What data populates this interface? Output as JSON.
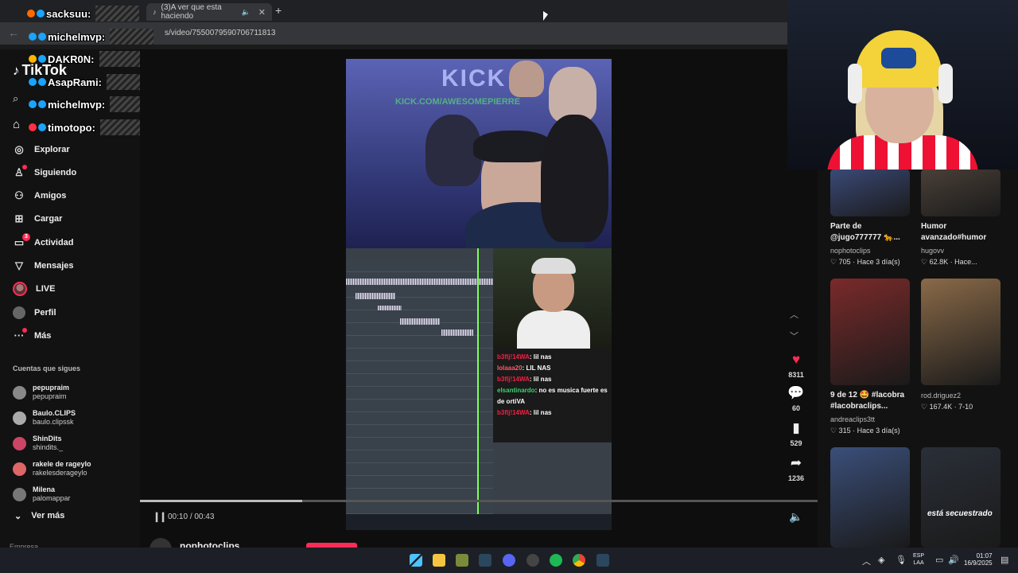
{
  "browser": {
    "tabs": [
      {
        "title": "(3)A ver que esta haciendo",
        "active": true
      }
    ],
    "url": "s/video/7550079590706711813"
  },
  "chat_overlay": [
    {
      "user": "sacksuu:",
      "color": "#ff6a00"
    },
    {
      "user": "michelmvp:",
      "color": "#1aa3ff"
    },
    {
      "user": "DAKR0N:",
      "color": "#ffb400"
    },
    {
      "user": "AsapRami:",
      "color": "#1aa3ff"
    },
    {
      "user": "michelmvp:",
      "color": "#1aa3ff"
    },
    {
      "user": "timotopo:",
      "color": "#ff3040"
    }
  ],
  "sidebar": {
    "logo": "TikTok",
    "items": [
      {
        "label": "Explorar",
        "icon": "compass-icon",
        "glyph": "◎"
      },
      {
        "label": "Siguiendo",
        "icon": "person-icon",
        "glyph": "👤"
      },
      {
        "label": "Amigos",
        "icon": "friends-icon",
        "glyph": "👥"
      },
      {
        "label": "Cargar",
        "icon": "upload-icon",
        "glyph": "⊞"
      },
      {
        "label": "Actividad",
        "icon": "activity-icon",
        "glyph": "▭",
        "badge": "3"
      },
      {
        "label": "Mensajes",
        "icon": "messages-icon",
        "glyph": "▽"
      },
      {
        "label": "LIVE",
        "icon": "live-icon"
      },
      {
        "label": "Perfil",
        "icon": "profile-icon"
      },
      {
        "label": "Más",
        "icon": "more-icon",
        "glyph": "···"
      }
    ],
    "following_title": "Cuentas que sigues",
    "following": [
      {
        "name": "pepupraim",
        "handle": "pepupraim",
        "color": "#888"
      },
      {
        "name": "Baulo.CLIPS",
        "handle": "baulo.clipssk",
        "color": "#aaa"
      },
      {
        "name": "ShinDits",
        "handle": "shindits._",
        "color": "#c46"
      },
      {
        "name": "rakele de rageylo",
        "handle": "rakelesderageylo",
        "color": "#d66"
      },
      {
        "name": "Milena",
        "handle": "palomappar",
        "color": "#777"
      }
    ],
    "see_more": "Ver más",
    "section_hint": "Empresa"
  },
  "video": {
    "watermark": "KICK",
    "watermark_url": "KICK.COM/AWESOMEPIERRE",
    "chat": [
      {
        "user": "b3flj!14WA",
        "text": ": lil nas",
        "cls": "u1"
      },
      {
        "user": "lolaaa20",
        "text": ": LIL NAS",
        "cls": "u2"
      },
      {
        "user": "b3flj!14WA",
        "text": ": lil nas",
        "cls": "u1"
      },
      {
        "user": "elsantinardo",
        "text": ": no es musica fuerte es de ortiVA",
        "cls": "u3"
      },
      {
        "user": "b3flj!14WA",
        "text": ": lil nas",
        "cls": "u1"
      }
    ],
    "current_time": "00:10",
    "duration": "00:43",
    "progress": 0.24,
    "author": "nophotoclips"
  },
  "actions": {
    "likes": "8311",
    "comments": "60",
    "saves": "529",
    "shares": "1236"
  },
  "recommendations": [
    {
      "title": "Parte de @jugo777777 🐆...",
      "author": "nophotoclips",
      "meta": "♡ 705 · Hace 3 día(s)",
      "tone": "#3b4a78"
    },
    {
      "title": "Humor avanzado#humor",
      "author": "hugovv",
      "meta": "♡ 62.8K · Hace...",
      "tone": "#4a4038"
    },
    {
      "title": "9 de 12 🤩 #lacobra #lacobraclips...",
      "author": "andreaclips3tt",
      "meta": "♡ 315 · Hace 3 día(s)",
      "tone": "#7a2a2a"
    },
    {
      "title": "",
      "author": "rod.driguez2",
      "meta": "♡ 167.4K · 7-10",
      "tone": "#8a6a48"
    },
    {
      "title": "",
      "author": "",
      "meta": "",
      "tone": "#3b4f7a"
    },
    {
      "title": "",
      "author": "",
      "meta": "",
      "tone": "#2a2f38",
      "caption": "está secuestrado"
    }
  ],
  "taskbar": {
    "lang_top": "ESP",
    "lang_bottom": "LAA",
    "time": "01:07",
    "date": "16/9/2025"
  }
}
